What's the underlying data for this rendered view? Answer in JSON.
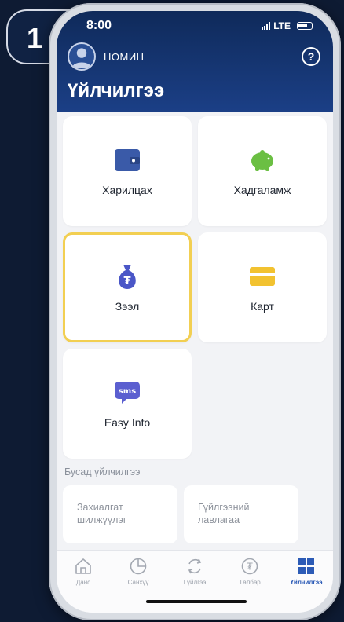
{
  "step": "1",
  "status_bar": {
    "time": "8:00",
    "network": "LTE"
  },
  "user": {
    "name": "НОМИН"
  },
  "header": {
    "title": "Үйлчилгээ",
    "help": "?"
  },
  "services": [
    {
      "label": "Харилцах",
      "icon": "wallet-icon",
      "color": "#3a5aa8"
    },
    {
      "label": "Хадгаламж",
      "icon": "piggy-bank-icon",
      "color": "#6bbf43"
    },
    {
      "label": "Зээл",
      "icon": "money-bag-icon",
      "color": "#4a56c7",
      "selected": true
    },
    {
      "label": "Карт",
      "icon": "card-icon",
      "color": "#f2c230"
    },
    {
      "label": "Easy Info",
      "icon": "sms-icon",
      "color": "#5b5fd0"
    }
  ],
  "other_services": {
    "title": "Бусад үйлчилгээ",
    "items": [
      "Захиалгат\nшилжүүлэг",
      "Гүйлгээний\nлавлагаа"
    ]
  },
  "tabs": [
    {
      "label": "Данс",
      "icon": "home-icon"
    },
    {
      "label": "Санхүү",
      "icon": "chart-icon"
    },
    {
      "label": "Гүйлгээ",
      "icon": "transfer-icon"
    },
    {
      "label": "Төлбөр",
      "icon": "payment-icon"
    },
    {
      "label": "Үйлчилгээ",
      "icon": "grid-icon",
      "active": true
    }
  ],
  "colors": {
    "accent": "#2c5bb6",
    "header": "#1b3f86",
    "selected_border": "#f2cf52"
  }
}
